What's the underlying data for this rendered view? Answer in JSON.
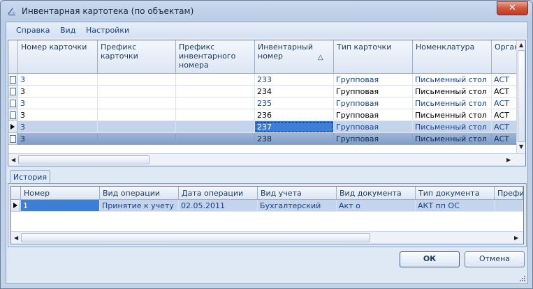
{
  "window": {
    "title": "Инвентарная картотека (по объектам)",
    "close_glyph": "✕"
  },
  "menu": [
    {
      "label": "Справка"
    },
    {
      "label": "Вид"
    },
    {
      "label": "Настройки"
    }
  ],
  "top_grid": {
    "columns": [
      "Номер карточки",
      "Префикс карточки",
      "Префикс инвентарного номера",
      "Инвентарный номер",
      "Тип карточки",
      "Номенклатура",
      "Орган"
    ],
    "sort_glyph": "△",
    "rows": [
      [
        "3",
        "",
        "",
        "233",
        "Групповая",
        "Письменный стол",
        "АСТ"
      ],
      [
        "3",
        "",
        "",
        "234",
        "Групповая",
        "Письменный стол",
        "АСТ"
      ],
      [
        "3",
        "",
        "",
        "235",
        "Групповая",
        "Письменный стол",
        "АСТ"
      ],
      [
        "3",
        "",
        "",
        "236",
        "Групповая",
        "Письменный стол",
        "АСТ"
      ],
      [
        "3",
        "",
        "",
        "237",
        "Групповая",
        "Письменный стол",
        "АСТ"
      ],
      [
        "3",
        "",
        "",
        "238",
        "Групповая",
        "Письменный стол",
        "АСТ"
      ]
    ]
  },
  "tabs": [
    {
      "label": "История"
    }
  ],
  "history_grid": {
    "columns": [
      "Номер",
      "Вид операции",
      "Дата операции",
      "Вид учета",
      "Вид документа",
      "Тип документа",
      "Префикс"
    ],
    "rows": [
      [
        "1",
        "Принятие к учету",
        "02.05.2011",
        "Бухгалтерский",
        "Акт о",
        "АКТ пп ОС",
        ""
      ]
    ]
  },
  "buttons": {
    "ok": "ОК",
    "cancel": "Отмена"
  },
  "colors": {
    "link_text": "#15428b",
    "selected_row": "#c3d4ec",
    "dark_row": "#7f9cc7"
  }
}
